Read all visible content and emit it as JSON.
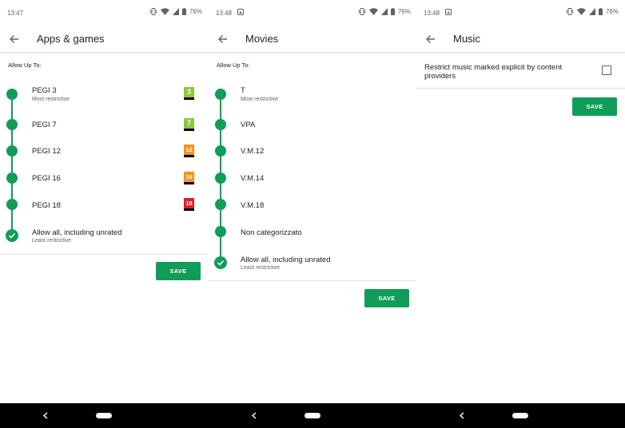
{
  "screens": [
    {
      "status_time": "13:47",
      "battery": "76%",
      "title": "Apps & games",
      "section_label": "Allow Up To:",
      "ratings": [
        {
          "name": "PEGI 3",
          "sub": "Most restrictive",
          "badge": "3",
          "badge_color": "#8dc63f"
        },
        {
          "name": "PEGI 7",
          "sub": "",
          "badge": "7",
          "badge_color": "#8dc63f"
        },
        {
          "name": "PEGI 12",
          "sub": "",
          "badge": "12",
          "badge_color": "#f7941d"
        },
        {
          "name": "PEGI 16",
          "sub": "",
          "badge": "16",
          "badge_color": "#f7941d"
        },
        {
          "name": "PEGI 18",
          "sub": "",
          "badge": "18",
          "badge_color": "#e31e24"
        },
        {
          "name": "Allow all, including unrated",
          "sub": "Least restrictive",
          "selected": true
        }
      ],
      "save_label": "SAVE"
    },
    {
      "status_time": "13:48",
      "battery": "76%",
      "title": "Movies",
      "section_label": "Allow Up To:",
      "ratings": [
        {
          "name": "T",
          "sub": "Most restrictive"
        },
        {
          "name": "VPA",
          "sub": ""
        },
        {
          "name": "V.M.12",
          "sub": ""
        },
        {
          "name": "V.M.14",
          "sub": ""
        },
        {
          "name": "V.M.18",
          "sub": ""
        },
        {
          "name": "Non categorizzato",
          "sub": ""
        },
        {
          "name": "Allow all, including unrated",
          "sub": "Least restrictive",
          "selected": true
        }
      ],
      "save_label": "SAVE"
    },
    {
      "status_time": "13:48",
      "battery": "76%",
      "title": "Music",
      "option_text": "Restrict music marked explicit by content providers",
      "option_checked": false,
      "save_label": "SAVE"
    }
  ],
  "colors": {
    "accent": "#0f9d58"
  }
}
